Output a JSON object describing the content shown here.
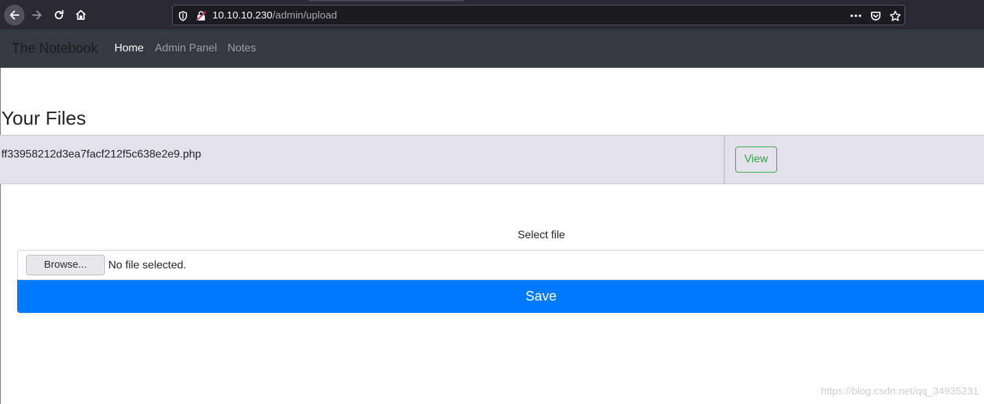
{
  "browser": {
    "url_host": "10.10.10.230",
    "url_path": "/admin/upload",
    "icons": {
      "back": "back-arrow-icon",
      "forward": "forward-arrow-icon",
      "reload": "reload-icon",
      "home": "home-icon",
      "shield": "tracking-shield-icon",
      "lock": "insecure-lock-icon",
      "more": "more-options-icon",
      "pocket": "pocket-icon",
      "bookmark": "bookmark-star-icon"
    }
  },
  "navbar": {
    "brand": "The Notebook",
    "links": [
      {
        "label": "Home",
        "active": true
      },
      {
        "label": "Admin Panel",
        "active": false
      },
      {
        "label": "Notes",
        "active": false
      }
    ]
  },
  "main": {
    "heading": "Your Files",
    "files": [
      {
        "name": "ff33958212d3ea7facf212f5c638e2e9.php",
        "action_label": "View"
      }
    ],
    "upload": {
      "label": "Select file",
      "browse_label": "Browse...",
      "status": "No file selected.",
      "save_label": "Save"
    }
  },
  "watermark": "https://blog.csdn.net/qq_34935231",
  "colors": {
    "browser_bg": "#2b2a33",
    "navbar_bg": "#343a40",
    "table_bg": "#e4e1eb",
    "save_button": "#007bff",
    "view_button": "#28a745"
  }
}
